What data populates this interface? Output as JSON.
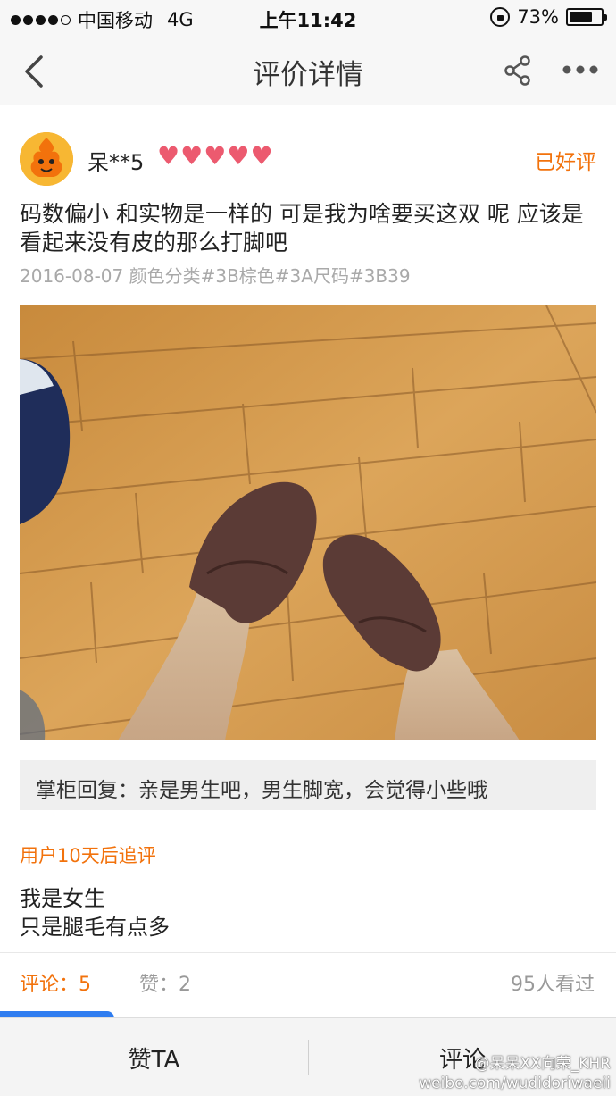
{
  "status_bar": {
    "carrier": "中国移动",
    "network": "4G",
    "time": "上午11:42",
    "battery": "73%",
    "battery_level": 0.73
  },
  "nav": {
    "title": "评价详情",
    "icons": [
      "back-icon",
      "share-icon",
      "more-icon"
    ]
  },
  "review": {
    "username": "呆**5",
    "hearts": [
      "♥",
      "♥",
      "♥",
      "♥",
      "♥"
    ],
    "status": "已好评",
    "text": "码数偏小 和实物是一样的 可是我为啥要买这双 呢 应该是看起来没有皮的那么打脚吧",
    "meta": "2016-08-07 颜色分类#3B棕色#3A尺码#3B39"
  },
  "seller_reply": {
    "text": "掌柜回复：亲是男生吧，男生脚宽，会觉得小些哦"
  },
  "followup": {
    "label": "用户10天后追评",
    "line1": "我是女生",
    "line2": "只是腿毛有点多"
  },
  "stats": {
    "comments": "评论：5",
    "likes": "赞：2",
    "views": "95人看过"
  },
  "bottom_bar": {
    "like_label": "赞TA",
    "comment_label": "评论"
  },
  "watermark": {
    "user": "@呆呆XX向荣_KHR",
    "url": "weibo.com/wudidoriwaeii"
  },
  "colors": {
    "accent": "#f2720c",
    "heart": "#ec5a6f",
    "reply_bg": "#efefef",
    "tab_blue": "#2f7df0"
  }
}
